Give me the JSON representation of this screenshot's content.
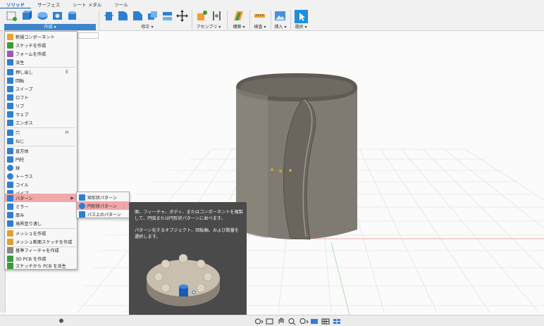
{
  "ribbon": {
    "tabs": [
      {
        "label": "ソリッド",
        "active": true
      },
      {
        "label": "サーフェス",
        "active": false
      },
      {
        "label": "シート メタル",
        "active": false
      },
      {
        "label": "ツール",
        "active": false
      }
    ],
    "groups": {
      "create": "作成 ▾",
      "modify": "修正 ▾",
      "assemble": "アセンブリ ▾",
      "construct": "構築 ▾",
      "inspect": "検査 ▾",
      "insert": "挿入 ▾",
      "select": "選択 ▾"
    }
  },
  "create_menu": {
    "items": [
      {
        "label": "新規コンポーネント",
        "shortcut": "",
        "icon": "new-component-icon"
      },
      {
        "label": "スケッチを作成",
        "shortcut": "",
        "icon": "sketch-icon"
      },
      {
        "label": "フォームを作成",
        "shortcut": "",
        "icon": "form-icon"
      },
      {
        "label": "派生",
        "shortcut": "",
        "icon": "derive-icon"
      },
      {
        "label": "押し出し",
        "shortcut": "E",
        "icon": "extrude-icon"
      },
      {
        "label": "回転",
        "shortcut": "",
        "icon": "revolve-icon"
      },
      {
        "label": "スイープ",
        "shortcut": "",
        "icon": "sweep-icon"
      },
      {
        "label": "ロフト",
        "shortcut": "",
        "icon": "loft-icon"
      },
      {
        "label": "リブ",
        "shortcut": "",
        "icon": "rib-icon"
      },
      {
        "label": "ウェブ",
        "shortcut": "",
        "icon": "web-icon"
      },
      {
        "label": "エンボス",
        "shortcut": "",
        "icon": "emboss-icon"
      },
      {
        "label": "穴",
        "shortcut": "H",
        "icon": "hole-icon"
      },
      {
        "label": "ねじ",
        "shortcut": "",
        "icon": "thread-icon"
      },
      {
        "label": "直方体",
        "shortcut": "",
        "icon": "box-icon"
      },
      {
        "label": "円柱",
        "shortcut": "",
        "icon": "cylinder-icon"
      },
      {
        "label": "球",
        "shortcut": "",
        "icon": "sphere-icon"
      },
      {
        "label": "トーラス",
        "shortcut": "",
        "icon": "torus-icon"
      },
      {
        "label": "コイル",
        "shortcut": "",
        "icon": "coil-icon"
      },
      {
        "label": "パイプ",
        "shortcut": "",
        "icon": "pipe-icon"
      },
      {
        "label": "パターン",
        "shortcut": "",
        "icon": "pattern-icon"
      },
      {
        "label": "ミラー",
        "shortcut": "",
        "icon": "mirror-icon"
      },
      {
        "label": "厚み",
        "shortcut": "",
        "icon": "thicken-icon"
      },
      {
        "label": "境界塗り潰し",
        "shortcut": "",
        "icon": "boundary-fill-icon"
      },
      {
        "label": "メッシュを作成",
        "shortcut": "",
        "icon": "mesh-icon"
      },
      {
        "label": "メッシュ断面スケッチを作成",
        "shortcut": "",
        "icon": "mesh-section-icon"
      },
      {
        "label": "基準フィーチャを作成",
        "shortcut": "",
        "icon": "base-feature-icon"
      },
      {
        "label": "3D PCB を作成",
        "shortcut": "",
        "icon": "pcb-3d-icon"
      },
      {
        "label": "スケッチから PCB を派生",
        "shortcut": "",
        "icon": "pcb-derive-icon"
      }
    ]
  },
  "pattern_submenu": {
    "items": [
      {
        "label": "矩形状パターン",
        "icon": "rect-pattern-icon"
      },
      {
        "label": "円形状パターン",
        "icon": "circular-pattern-icon"
      },
      {
        "label": "パス上のパターン",
        "icon": "path-pattern-icon"
      }
    ]
  },
  "tooltip": {
    "description": "面、フィーチャ、ボディ、またはコンポーネントを複製して、円弧または円形状パターンに並べます。",
    "detail": "パターン化するオブジェクト、回転軸、および数量を選択します。"
  },
  "colors": {
    "create_group": "#3c84cc",
    "menu_highlight": "#f0a8a8",
    "tooltip_bg": "#4a4a4a",
    "model": "#7f7b72",
    "select_button": "#1d8ee0"
  }
}
